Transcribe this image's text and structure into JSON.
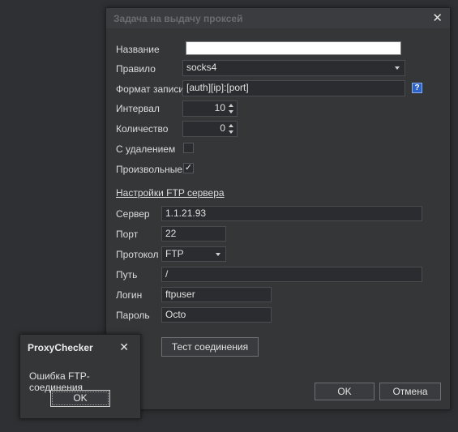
{
  "dialog": {
    "title": "Задача на выдачу проксей",
    "close_glyph": "✕",
    "labels": {
      "name": "Название",
      "rule": "Правило",
      "format": "Формат записи",
      "interval": "Интервал",
      "count": "Количество",
      "delete": "С удалением",
      "random": "Произвольные"
    },
    "values": {
      "name": "",
      "rule": "socks4",
      "format": "[auth][ip]:[port]",
      "interval": "10",
      "count": "0",
      "delete_checked": false,
      "random_checked": true,
      "check_glyph": "✓",
      "help_glyph": "?"
    },
    "ftp": {
      "section_title": "Настройки FTP сервера",
      "labels": {
        "server": "Сервер",
        "port": "Порт",
        "protocol": "Протокол",
        "path": "Путь",
        "login": "Логин",
        "password": "Пароль"
      },
      "values": {
        "server": "1.1.21.93",
        "port": "22",
        "protocol": "FTP",
        "path": "/",
        "login": "ftpuser",
        "password": "Octo"
      },
      "test_button": "Тест соединения"
    },
    "ok_button": "OK",
    "cancel_button": "Отмена"
  },
  "messagebox": {
    "title": "ProxyChecker",
    "close_glyph": "✕",
    "text": "Ошибка FTP-соединения",
    "ok_button": "OK"
  }
}
